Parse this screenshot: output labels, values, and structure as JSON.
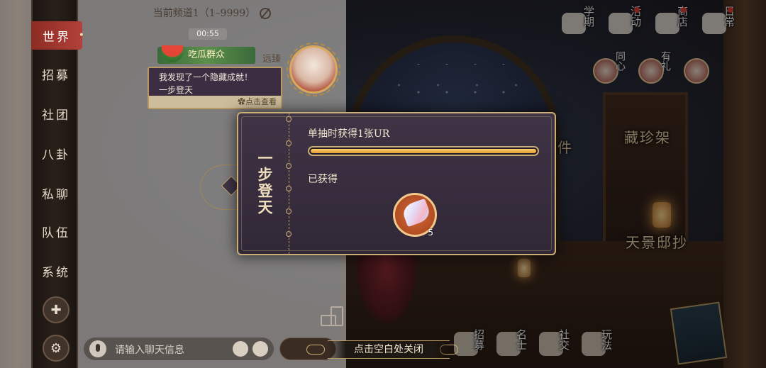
{
  "chat": {
    "header": "当前频道1（1–9999）",
    "time": "00:55",
    "tabs": [
      {
        "label": "世界"
      },
      {
        "label": "招募"
      },
      {
        "label": "社团"
      },
      {
        "label": "八卦"
      },
      {
        "label": "私聊"
      },
      {
        "label": "队伍"
      },
      {
        "label": "系统"
      }
    ],
    "active_tab": "世界",
    "message": {
      "group_badge": "吃瓜群众",
      "author": "远臻",
      "line1": "我发现了一个隐藏成就！",
      "line2": "一步登天",
      "footer": "✿点击查看"
    },
    "input_placeholder": "请输入聊天信息"
  },
  "scene": {
    "top_icons": [
      {
        "label": "学期",
        "icon": "book-icon"
      },
      {
        "label": "活动",
        "icon": "bag-icon"
      },
      {
        "label": "商店",
        "icon": "shop-icon"
      },
      {
        "label": "日常",
        "icon": "scroll-icon"
      }
    ],
    "mid_icons": [
      {
        "label": "同心",
        "icon": "lotus-icon"
      },
      {
        "label": "有礼",
        "icon": "fox-icon"
      }
    ],
    "labels": {
      "shelf": "藏珍架",
      "case": "件",
      "scene_bottom": "天景邸抄"
    },
    "bottom_nav": [
      {
        "label": "招募"
      },
      {
        "label": "名士"
      },
      {
        "label": "社交"
      },
      {
        "label": "玩法"
      }
    ]
  },
  "modal": {
    "title": "一步登天",
    "task": "单抽时获得1张UR",
    "progress": 1.0,
    "obtained_label": "已获得",
    "reward": {
      "icon": "crystal-icon",
      "count": "5"
    }
  },
  "close_hint": "点击空白处关闭"
}
